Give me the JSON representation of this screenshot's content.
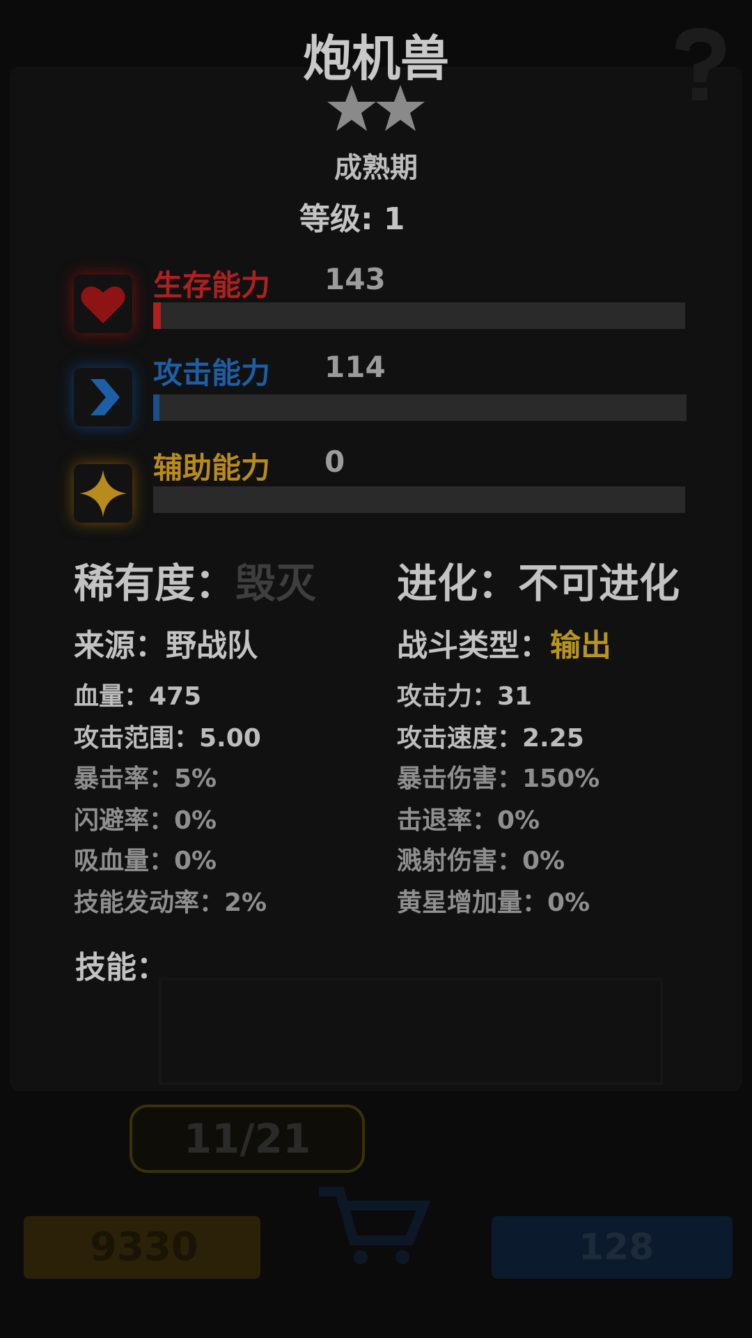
{
  "unit": {
    "name": "炮机兽",
    "star_count": 2,
    "stage": "成熟期",
    "level_text": "等级: 1"
  },
  "abilities": [
    {
      "label": "生存能力",
      "value": "143",
      "ratio": 0.014,
      "color": "#b0201f",
      "icon": "heart-icon"
    },
    {
      "label": "攻击能力",
      "value": "114",
      "ratio": 0.012,
      "color": "#1c5fa6",
      "icon": "chevron-right-icon"
    },
    {
      "label": "辅助能力",
      "value": "0",
      "ratio": 0.0,
      "color": "#b98a1c",
      "icon": "sparkle-star-icon"
    }
  ],
  "rarity": {
    "label": "稀有度：",
    "value": "毁灭"
  },
  "evolution": {
    "label": "进化：",
    "value": "不可进化"
  },
  "source": {
    "label": "来源：",
    "value": "野战队"
  },
  "combat_type": {
    "label": "战斗类型：",
    "value": "输出"
  },
  "stats_left": [
    "血量：475",
    "攻击范围：5.00",
    "暴击率：5%",
    "闪避率：0%",
    "吸血量：0%",
    "技能发动率：2%"
  ],
  "stats_right": [
    "攻击力：31",
    "攻击速度：2.25",
    "暴击伤害：150%",
    "击退率：0%",
    "溅射伤害：0%",
    "黄星增加量：0%"
  ],
  "skills_label": "技能：",
  "background": {
    "counter": "11/21",
    "gold_amount": "9330",
    "star_amount": "128"
  },
  "colors": {
    "title": "#c9c9c9",
    "stat_bright": "#bdbdbd",
    "stat_dim": "#8f8f8f",
    "rarity_value": "#3e3e3e",
    "combat_type_value": "#b8961e"
  }
}
